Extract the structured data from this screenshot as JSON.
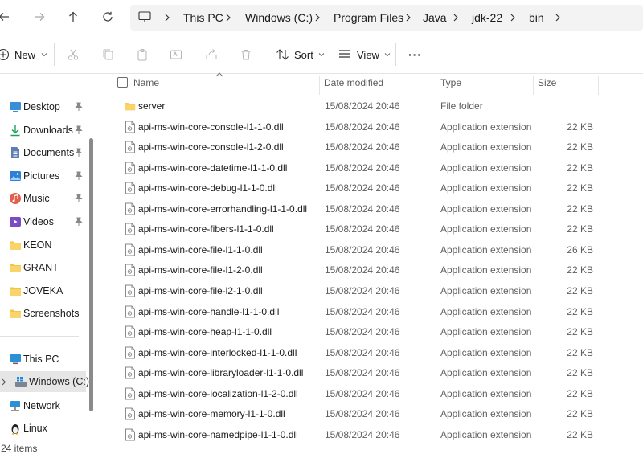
{
  "breadcrumb": [
    "This PC",
    "Windows (C:)",
    "Program Files",
    "Java",
    "jdk-22",
    "bin"
  ],
  "toolbar": {
    "new_label": "New",
    "sort_label": "Sort",
    "view_label": "View",
    "more_label": "···"
  },
  "sidebar": {
    "quick_access": [
      {
        "label": "Desktop",
        "icon": "desktop-icon",
        "pinned": true
      },
      {
        "label": "Downloads",
        "icon": "download-icon",
        "pinned": true
      },
      {
        "label": "Documents",
        "icon": "document-icon",
        "pinned": true
      },
      {
        "label": "Pictures",
        "icon": "pictures-icon",
        "pinned": true
      },
      {
        "label": "Music",
        "icon": "music-icon",
        "pinned": true
      },
      {
        "label": "Videos",
        "icon": "videos-icon",
        "pinned": true
      },
      {
        "label": "KEON",
        "icon": "folder-icon",
        "pinned": false
      },
      {
        "label": "GRANT",
        "icon": "folder-icon",
        "pinned": false
      },
      {
        "label": "JOVEKA",
        "icon": "folder-icon",
        "pinned": false
      },
      {
        "label": "Screenshots",
        "icon": "folder-icon",
        "pinned": false
      }
    ],
    "devices": [
      {
        "label": "This PC",
        "icon": "computer-icon"
      },
      {
        "label": "Windows (C:)",
        "icon": "drive-icon"
      },
      {
        "label": "Network",
        "icon": "network-icon"
      },
      {
        "label": "Linux",
        "icon": "linux-icon"
      }
    ]
  },
  "columns": {
    "name": "Name",
    "date": "Date modified",
    "type": "Type",
    "size": "Size"
  },
  "files": [
    {
      "name": "server",
      "date": "15/08/2024 20:46",
      "type": "File folder",
      "size": ""
    },
    {
      "name": "api-ms-win-core-console-l1-1-0.dll",
      "date": "15/08/2024 20:46",
      "type": "Application extension",
      "size": "22 KB"
    },
    {
      "name": "api-ms-win-core-console-l1-2-0.dll",
      "date": "15/08/2024 20:46",
      "type": "Application extension",
      "size": "22 KB"
    },
    {
      "name": "api-ms-win-core-datetime-l1-1-0.dll",
      "date": "15/08/2024 20:46",
      "type": "Application extension",
      "size": "22 KB"
    },
    {
      "name": "api-ms-win-core-debug-l1-1-0.dll",
      "date": "15/08/2024 20:46",
      "type": "Application extension",
      "size": "22 KB"
    },
    {
      "name": "api-ms-win-core-errorhandling-l1-1-0.dll",
      "date": "15/08/2024 20:46",
      "type": "Application extension",
      "size": "22 KB"
    },
    {
      "name": "api-ms-win-core-fibers-l1-1-0.dll",
      "date": "15/08/2024 20:46",
      "type": "Application extension",
      "size": "22 KB"
    },
    {
      "name": "api-ms-win-core-file-l1-1-0.dll",
      "date": "15/08/2024 20:46",
      "type": "Application extension",
      "size": "26 KB"
    },
    {
      "name": "api-ms-win-core-file-l1-2-0.dll",
      "date": "15/08/2024 20:46",
      "type": "Application extension",
      "size": "22 KB"
    },
    {
      "name": "api-ms-win-core-file-l2-1-0.dll",
      "date": "15/08/2024 20:46",
      "type": "Application extension",
      "size": "22 KB"
    },
    {
      "name": "api-ms-win-core-handle-l1-1-0.dll",
      "date": "15/08/2024 20:46",
      "type": "Application extension",
      "size": "22 KB"
    },
    {
      "name": "api-ms-win-core-heap-l1-1-0.dll",
      "date": "15/08/2024 20:46",
      "type": "Application extension",
      "size": "22 KB"
    },
    {
      "name": "api-ms-win-core-interlocked-l1-1-0.dll",
      "date": "15/08/2024 20:46",
      "type": "Application extension",
      "size": "22 KB"
    },
    {
      "name": "api-ms-win-core-libraryloader-l1-1-0.dll",
      "date": "15/08/2024 20:46",
      "type": "Application extension",
      "size": "22 KB"
    },
    {
      "name": "api-ms-win-core-localization-l1-2-0.dll",
      "date": "15/08/2024 20:46",
      "type": "Application extension",
      "size": "22 KB"
    },
    {
      "name": "api-ms-win-core-memory-l1-1-0.dll",
      "date": "15/08/2024 20:46",
      "type": "Application extension",
      "size": "22 KB"
    },
    {
      "name": "api-ms-win-core-namedpipe-l1-1-0.dll",
      "date": "15/08/2024 20:46",
      "type": "Application extension",
      "size": "22 KB"
    }
  ],
  "status": {
    "item_count": "24 items"
  },
  "colors": {
    "folder": "#f4c542",
    "accent": "#0067c0",
    "selected_bg": "#e6e6e6"
  }
}
